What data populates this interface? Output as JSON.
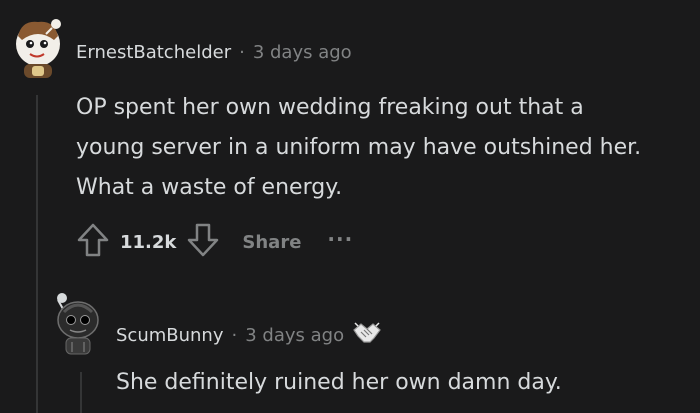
{
  "comment": {
    "username": "ErnestBatchelder",
    "separator": "·",
    "timestamp": "3 days ago",
    "body_lines": [
      "OP spent her own wedding freaking out that a",
      "young server in a uniform may have outshined her.",
      "What a waste of energy."
    ],
    "vote_count": "11.2k",
    "share_label": "Share",
    "more_label": "···"
  },
  "reply": {
    "username": "ScumBunny",
    "separator": "·",
    "timestamp": "3 days ago",
    "award_icon": "handshake-award-icon",
    "body": "She definitely ruined her own damn day."
  },
  "colors": {
    "background": "#1a1a1b",
    "text": "#d7dadc",
    "muted": "#818384",
    "thread_line": "#343536"
  }
}
